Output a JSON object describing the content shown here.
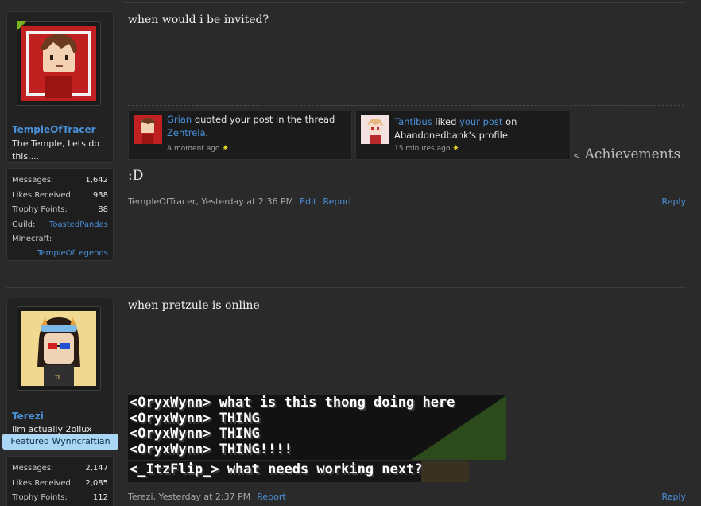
{
  "posts": [
    {
      "user": {
        "name": "TempleOfTracer",
        "title": "The Temple, Lets do this....",
        "stats": [
          {
            "label": "Messages:",
            "value": "1,642"
          },
          {
            "label": "Likes Received:",
            "value": "938"
          },
          {
            "label": "Trophy Points:",
            "value": "88"
          },
          {
            "label": "Guild:",
            "value": "ToastedPandas"
          },
          {
            "label": "Minecraft:",
            "value": "TempleOfLegends"
          }
        ]
      },
      "text": "when would i be invited?",
      "signature": {
        "notifications": [
          {
            "name": "Grian",
            "pre": " quoted your post in the thread ",
            "link": "Zentrela",
            "post": ".",
            "time": "A moment ago"
          },
          {
            "name": "Tantibus",
            "pre": " liked ",
            "link": "your post",
            "post": " on Abandonedbank's profile.",
            "time": "15 minutes ago"
          }
        ],
        "achievements": "Achievements",
        "achievements_prefix": "<",
        "smiley": ":D"
      },
      "meta": {
        "author_time": "TempleOfTracer, Yesterday at 2:36 PM",
        "edit": "Edit",
        "report": "Report",
        "reply": "Reply"
      }
    },
    {
      "user": {
        "name": "Terezi",
        "title": "Ilm actually 2ollux",
        "badge": "Featured Wynncraftian",
        "stats": [
          {
            "label": "Messages:",
            "value": "2,147"
          },
          {
            "label": "Likes Received:",
            "value": "2,085"
          },
          {
            "label": "Trophy Points:",
            "value": "112"
          }
        ]
      },
      "text": "when pretzule is online",
      "signature": {
        "chat_lines": [
          "<OryxWynn> what is this thong doing here",
          "<OryxWynn> THING",
          "<OryxWynn> THING",
          "<OryxWynn> THING!!!!",
          "<_ItzFlip_> what needs working next?"
        ]
      },
      "meta": {
        "author_time": "Terezi, Yesterday at 2:37 PM",
        "report": "Report",
        "reply": "Reply"
      }
    }
  ],
  "colors": {
    "link": "#4a90d9",
    "badge_bg": "#a9d6f4",
    "online": "#7ab31d",
    "background": "#2a2a2a"
  }
}
